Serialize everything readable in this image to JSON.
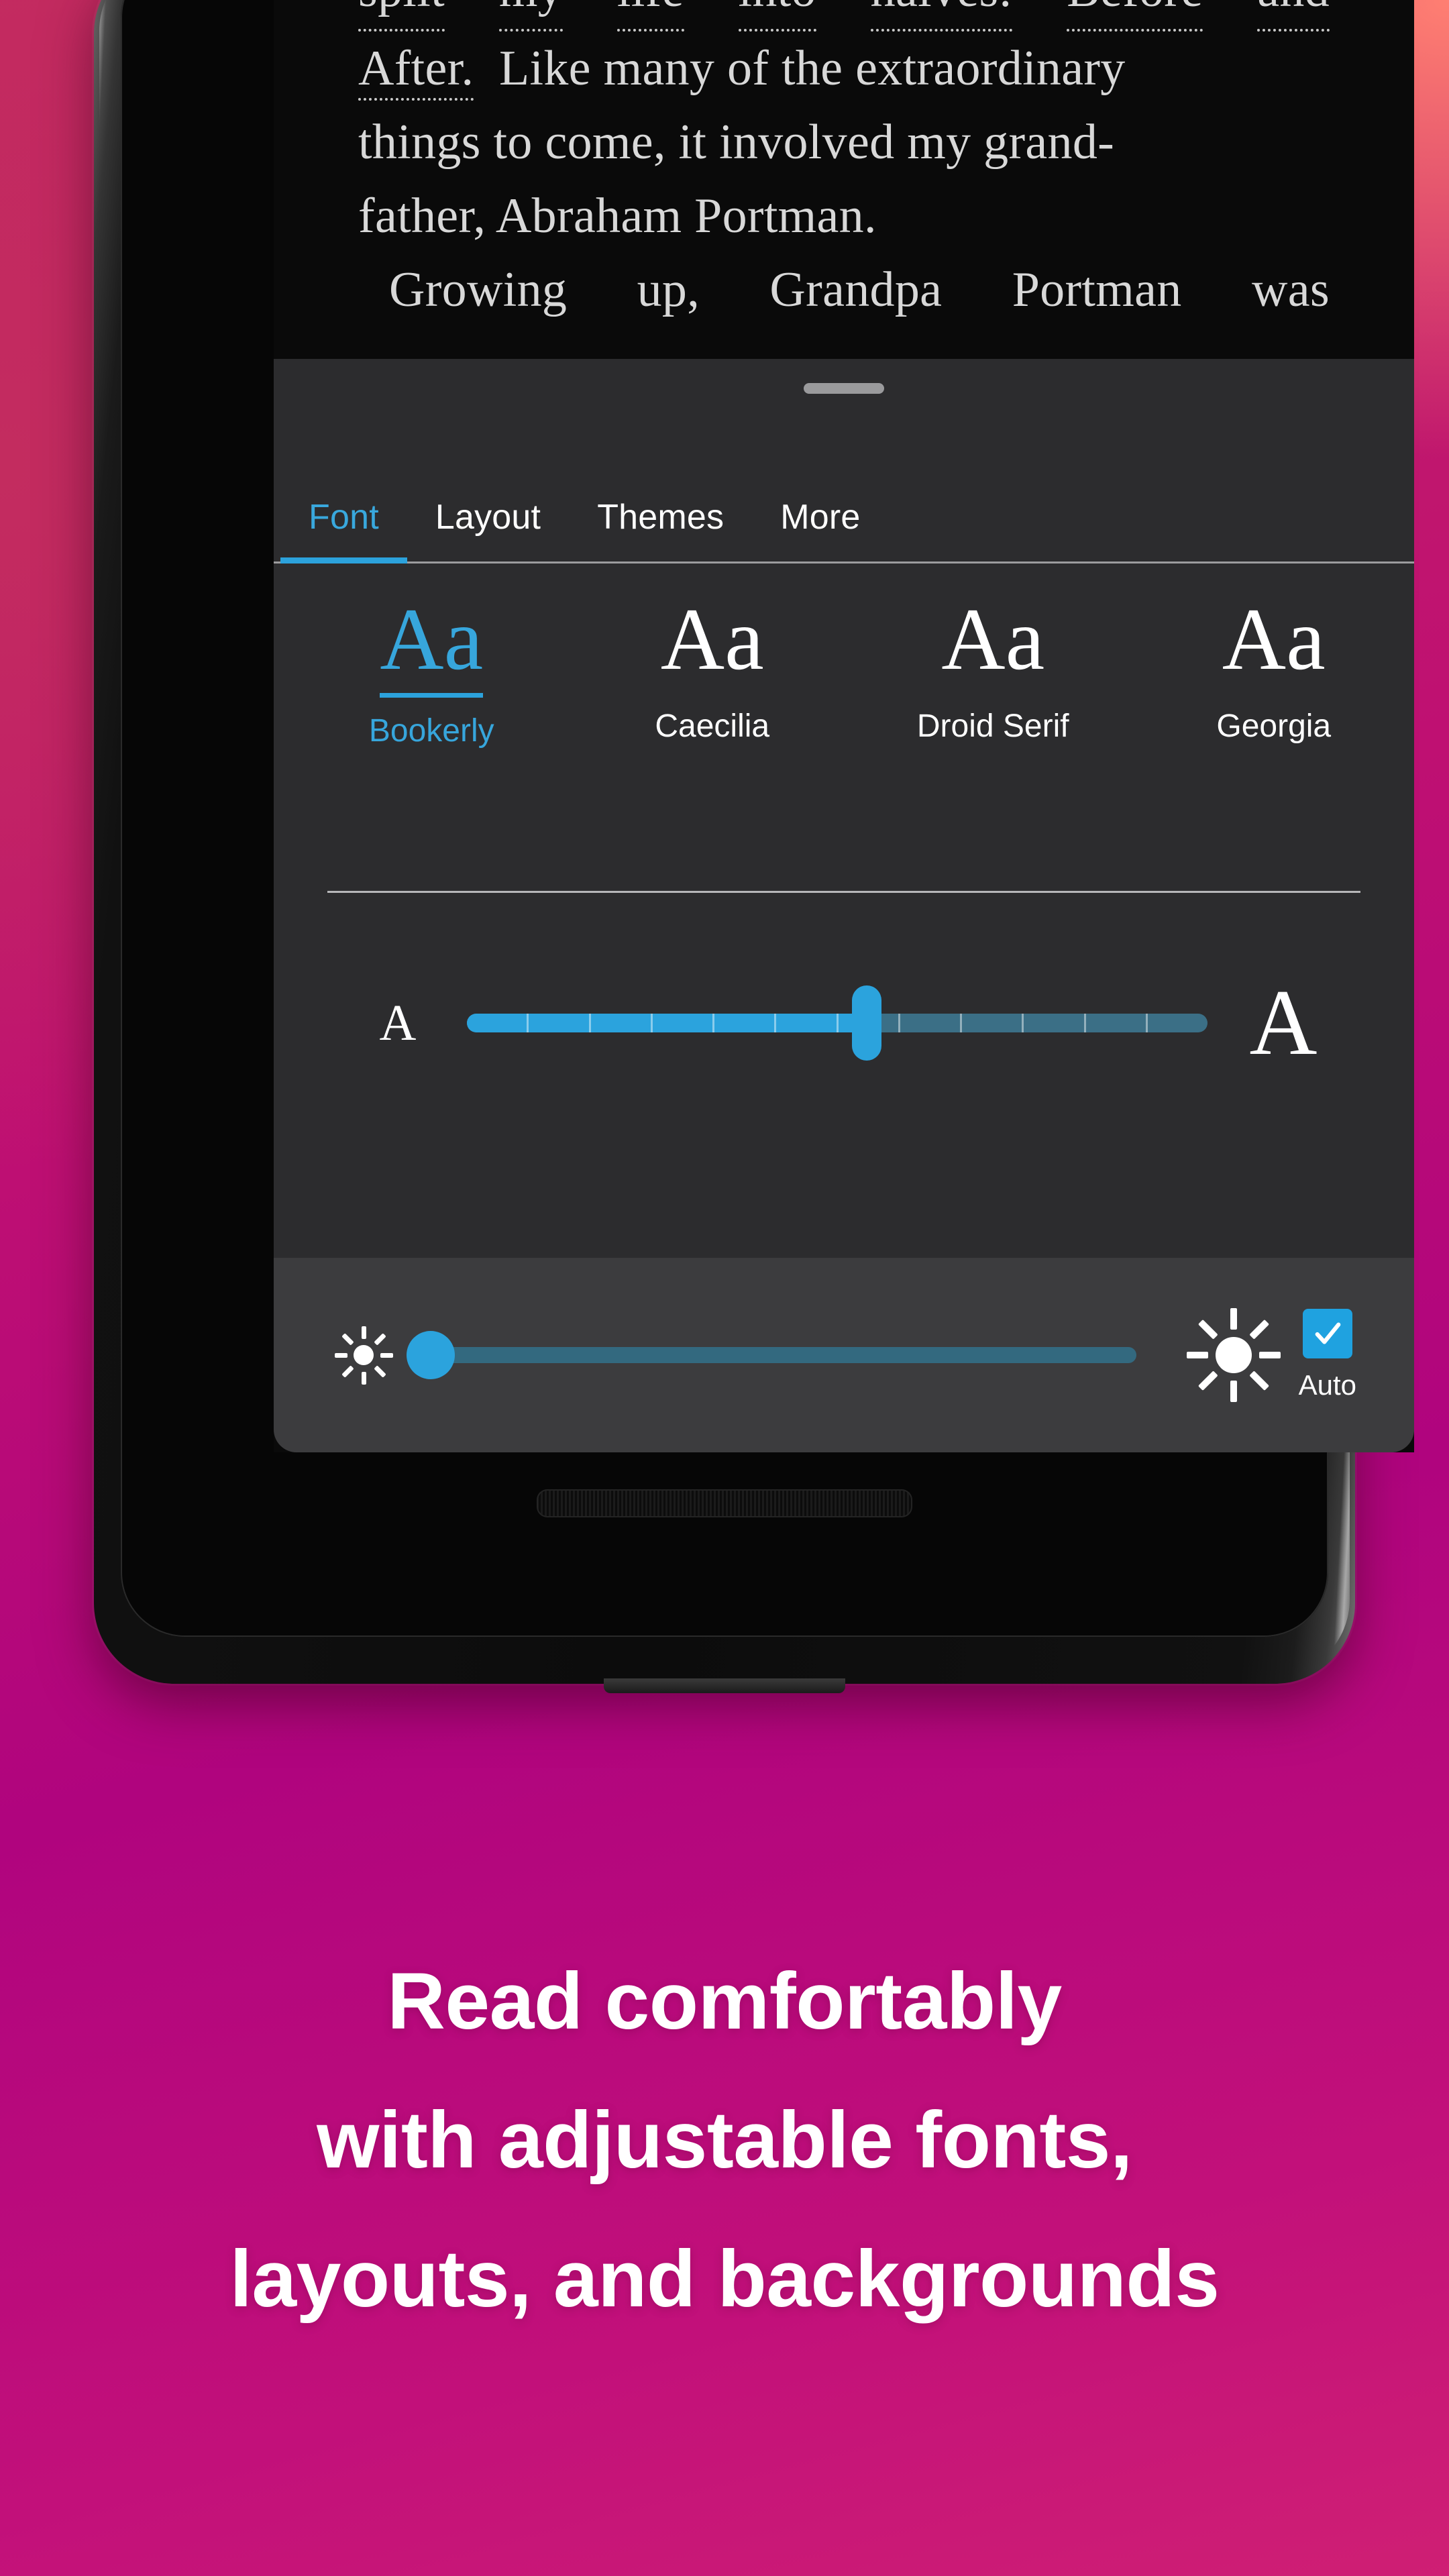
{
  "reader": {
    "lines": [
      "split my life into halves: Before and",
      "After. Like many of the extraordinary",
      "things to come, it involved my grand-",
      "father, Abraham Portman.",
      "Growing up, Grandpa Portman was"
    ],
    "line1_words": [
      "split",
      "my",
      "life",
      "into",
      "halves:",
      "Before",
      "and"
    ],
    "line5_words": [
      "Growing",
      "up,",
      "Grandpa",
      "Portman",
      "was"
    ]
  },
  "sheet": {
    "grabber": "drag-handle",
    "tabs": [
      {
        "label": "Font",
        "active": true
      },
      {
        "label": "Layout",
        "active": false
      },
      {
        "label": "Themes",
        "active": false
      },
      {
        "label": "More",
        "active": false
      }
    ],
    "font_options": [
      {
        "sample": "Aa",
        "name": "Bookerly",
        "selected": true
      },
      {
        "sample": "Aa",
        "name": "Caecilia",
        "selected": false
      },
      {
        "sample": "Aa",
        "name": "Droid Serif",
        "selected": false
      },
      {
        "sample": "Aa",
        "name": "Georgia",
        "selected": false
      }
    ],
    "font_size": {
      "min_label": "A",
      "max_label": "A",
      "value_percent": 54,
      "ticks": 12
    },
    "brightness": {
      "min_icon": "sun-small-icon",
      "max_icon": "sun-large-icon",
      "value_percent": 0,
      "auto_label": "Auto",
      "auto_checked": true
    }
  },
  "caption": {
    "line1": "Read comfortably",
    "line2": "with adjustable fonts,",
    "line3": "layouts, and backgrounds"
  },
  "colors": {
    "accent": "#2ba3dd",
    "sheet_bg": "#2c2c2e",
    "brightness_bg": "#3c3c3e",
    "reader_bg": "#0a0a0a",
    "reader_text": "#d8d8d8",
    "caption_text": "#ffffff",
    "bg_coral": "#ff7f72",
    "bg_crimson": "#c32a60",
    "bg_magenta": "#b0047e"
  }
}
